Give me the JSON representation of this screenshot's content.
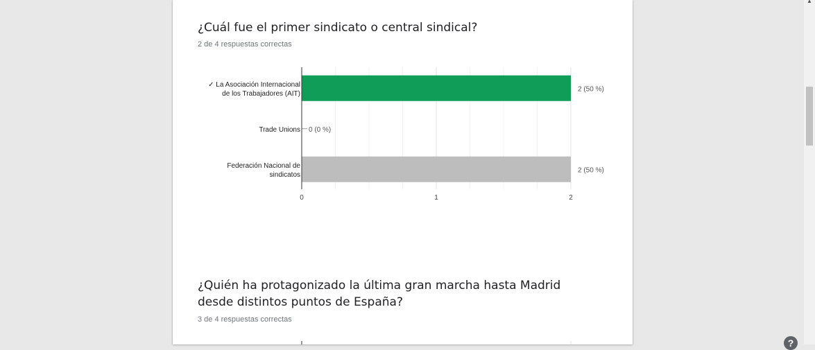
{
  "question1": {
    "title": "¿Cuál fue el primer sindicato o central sindical?",
    "subtitle": "2 de 4 respuestas correctas"
  },
  "question2": {
    "title": "¿Quién ha protagonizado la última gran marcha hasta Madrid desde distintos puntos de España?",
    "subtitle": "3 de 4 respuestas correctas"
  },
  "chart_data": {
    "type": "bar",
    "orientation": "horizontal",
    "categories": [
      [
        "✓ La Asociación Internacional",
        "de los Trabajadores (AIT)"
      ],
      [
        "Trade Unions"
      ],
      [
        "Federación Nacional de",
        "sindicatos"
      ]
    ],
    "values": [
      2,
      0,
      2
    ],
    "value_labels": [
      "2 (50 %)",
      "0 (0 %)",
      "2 (50 %)"
    ],
    "correct": [
      true,
      false,
      false
    ],
    "bar_colors": [
      "#0f9d58",
      "#bdbdbd",
      "#bdbdbd"
    ],
    "xlim": [
      0,
      2
    ],
    "xticks": [
      "0",
      "1",
      "2"
    ],
    "grid": true
  },
  "icons": {
    "help": "?",
    "scroll_up": "▲"
  },
  "colors": {
    "correct": "#0f9d58",
    "incorrect": "#bdbdbd",
    "background": "#e8e8e8"
  }
}
